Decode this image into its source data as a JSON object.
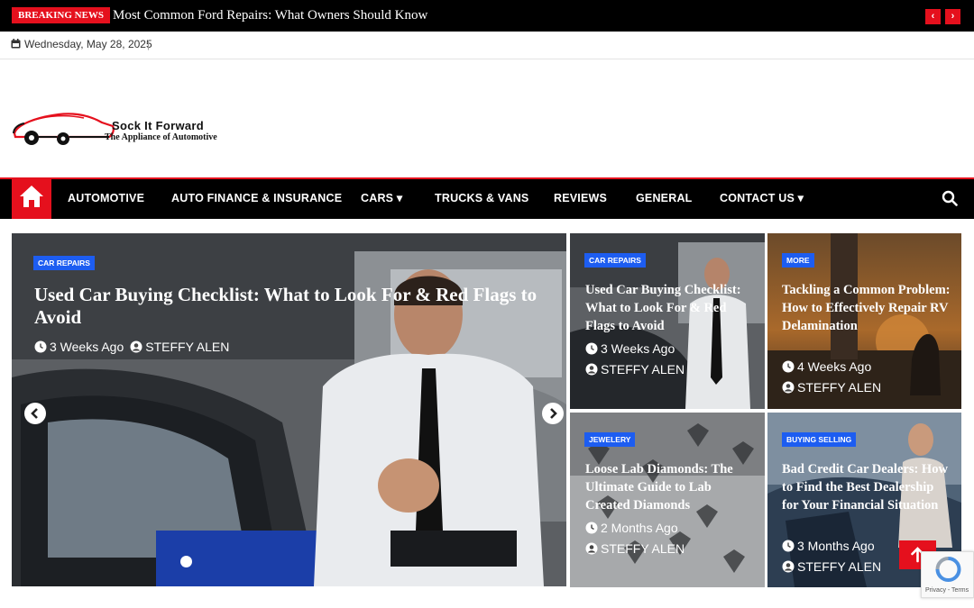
{
  "breaking": {
    "label": "BREAKING NEWS",
    "headline": "Most Common Ford Repairs: What Owners Should Know",
    "prev_icon": "chevron-left-icon",
    "next_icon": "chevron-right-icon",
    "prev_glyph": "‹",
    "next_glyph": "›"
  },
  "datebar": {
    "date": "Wednesday, May 28, 2025",
    "separator": "|"
  },
  "site": {
    "name": "Sock It Forward",
    "tagline": "The Appliance of Automotive"
  },
  "nav": {
    "items": [
      {
        "label": "AUTOMOTIVE"
      },
      {
        "label": "AUTO FINANCE & INSURANCE"
      },
      {
        "label": "CARS ▾"
      },
      {
        "label": "TRUCKS & VANS"
      },
      {
        "label": "REVIEWS"
      },
      {
        "label": "GENERAL"
      },
      {
        "label": "CONTACT US ▾"
      }
    ]
  },
  "featured": {
    "tag": "CAR REPAIRS",
    "title": "Used Car Buying Checklist: What to Look For & Red Flags to Avoid",
    "time": "3 Weeks Ago",
    "author": "STEFFY ALEN"
  },
  "cards": [
    {
      "tag": "CAR REPAIRS",
      "title": "Used Car Buying Checklist: What to Look For & Red Flags to Avoid",
      "time": "3 Weeks Ago",
      "author": "STEFFY ALEN"
    },
    {
      "tag": "MORE",
      "title": "Tackling a Common Problem: How to Effectively Repair RV Delamination",
      "time": "4 Weeks Ago",
      "author": "STEFFY ALEN"
    },
    {
      "tag": "JEWELERY",
      "title": "Loose Lab Diamonds: The Ultimate Guide to Lab Created Diamonds",
      "time": "2 Months Ago",
      "author": "STEFFY ALEN"
    },
    {
      "tag": "BUYING SELLING",
      "title": "Bad Credit Car Dealers: How to Find the Best Dealership for Your Financial Situation",
      "time": "3 Months Ago",
      "author": "STEFFY ALEN"
    }
  ],
  "recaptcha": {
    "text": "Privacy - Terms"
  },
  "colors": {
    "accent": "#e5101d",
    "tag_blue": "#1d5df1"
  }
}
